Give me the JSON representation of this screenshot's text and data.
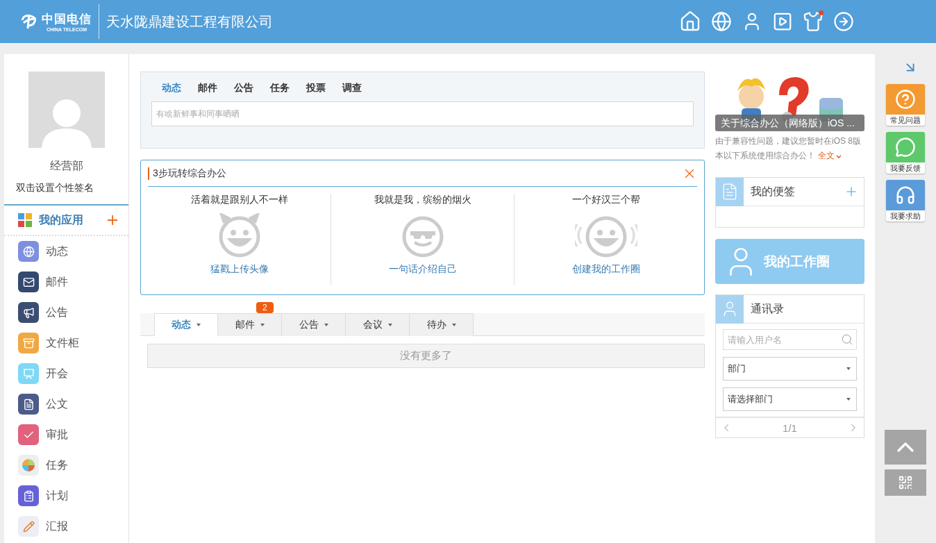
{
  "header": {
    "logo_cn": "中国电信",
    "logo_en": "CHINA TELECOM",
    "company": "天水陇鼎建设工程有限公司",
    "notification_dot": true
  },
  "profile": {
    "department": "经营部",
    "signature": "双击设置个性签名"
  },
  "apps": {
    "title": "我的应用",
    "items": [
      {
        "label": "动态"
      },
      {
        "label": "邮件"
      },
      {
        "label": "公告"
      },
      {
        "label": "文件柜"
      },
      {
        "label": "开会"
      },
      {
        "label": "公文"
      },
      {
        "label": "审批"
      },
      {
        "label": "任务"
      },
      {
        "label": "计划"
      },
      {
        "label": "汇报"
      }
    ]
  },
  "composer": {
    "tabs": [
      {
        "label": "动态",
        "selected": true
      },
      {
        "label": "邮件",
        "selected": false
      },
      {
        "label": "公告",
        "selected": false
      },
      {
        "label": "任务",
        "selected": false
      },
      {
        "label": "投票",
        "selected": false
      },
      {
        "label": "调查",
        "selected": false
      }
    ],
    "placeholder": "有啥新鲜事和同事晒晒"
  },
  "guide": {
    "title": "3步玩转综合办公",
    "steps": [
      {
        "caption": "活着就是跟别人不一样",
        "link": "猛戳上传头像"
      },
      {
        "caption": "我就是我，缤纷的烟火",
        "link": "一句话介绍自己"
      },
      {
        "caption": "一个好汉三个帮",
        "link": "创建我的工作圈"
      }
    ]
  },
  "feed": {
    "tabs": [
      {
        "label": "动态",
        "selected": true
      },
      {
        "label": "邮件",
        "selected": false,
        "badge": "2"
      },
      {
        "label": "公告",
        "selected": false
      },
      {
        "label": "会议",
        "selected": false
      },
      {
        "label": "待办",
        "selected": false
      }
    ],
    "empty": "没有更多了"
  },
  "news": {
    "caption": "关于综合办公（网络版）iOS ...",
    "text": "由于兼容性问题，建议您暂时在iOS 8版本以下系统使用综合办公！",
    "more": "全文"
  },
  "notes": {
    "title": "我的便签"
  },
  "work_circle": {
    "label": "我的工作圈"
  },
  "contacts": {
    "title": "通讯录",
    "search_placeholder": "请输入用户名",
    "filter": "部门",
    "department_select": "请选择部门",
    "page": "1/1"
  },
  "float_bar": {
    "buttons": [
      {
        "label": "常见问题",
        "color": "#f39a32"
      },
      {
        "label": "我要反馈",
        "color": "#5dc96a"
      },
      {
        "label": "我要求助",
        "color": "#5b9bd9"
      }
    ]
  }
}
